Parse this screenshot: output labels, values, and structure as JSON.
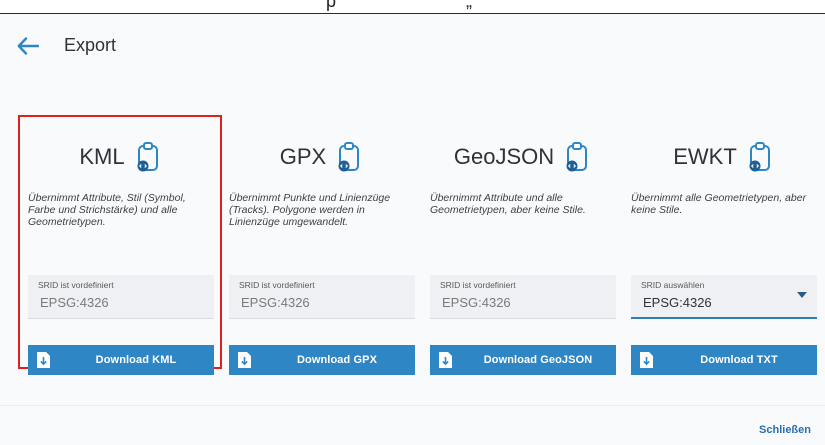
{
  "topbar": {
    "fragment": "p                          „"
  },
  "header": {
    "title": "Export",
    "back_icon": "arrow-left-icon"
  },
  "cards": [
    {
      "title": "KML",
      "description": "Übernimmt Attribute, Stil (Symbol, Farbe und Strichstärke) und alle Geometrietypen.",
      "srid_label": "SRID ist vordefiniert",
      "srid_value": "EPSG:4326",
      "download_label": "Download KML",
      "selected": true
    },
    {
      "title": "GPX",
      "description": "Übernimmt Punkte und Linienzüge (Tracks). Polygone werden in Linienzüge umgewandelt.",
      "srid_label": "SRID ist vordefiniert",
      "srid_value": "EPSG:4326",
      "download_label": "Download GPX"
    },
    {
      "title": "GeoJSON",
      "description": "Übernimmt Attribute und alle Geometrietypen, aber keine Stile.",
      "srid_label": "SRID ist vordefiniert",
      "srid_value": "EPSG:4326",
      "download_label": "Download GeoJSON"
    },
    {
      "title": "EWKT",
      "description": "Übernimmt alle Geometrietypen, aber keine Stile.",
      "srid_label": "SRID auswählen",
      "srid_value": "EPSG:4326",
      "download_label": "Download TXT"
    }
  ],
  "footer": {
    "close_label": "Schließen"
  },
  "colors": {
    "accent": "#2f86c4",
    "selection": "#e02020",
    "link": "#2a6fb0"
  }
}
